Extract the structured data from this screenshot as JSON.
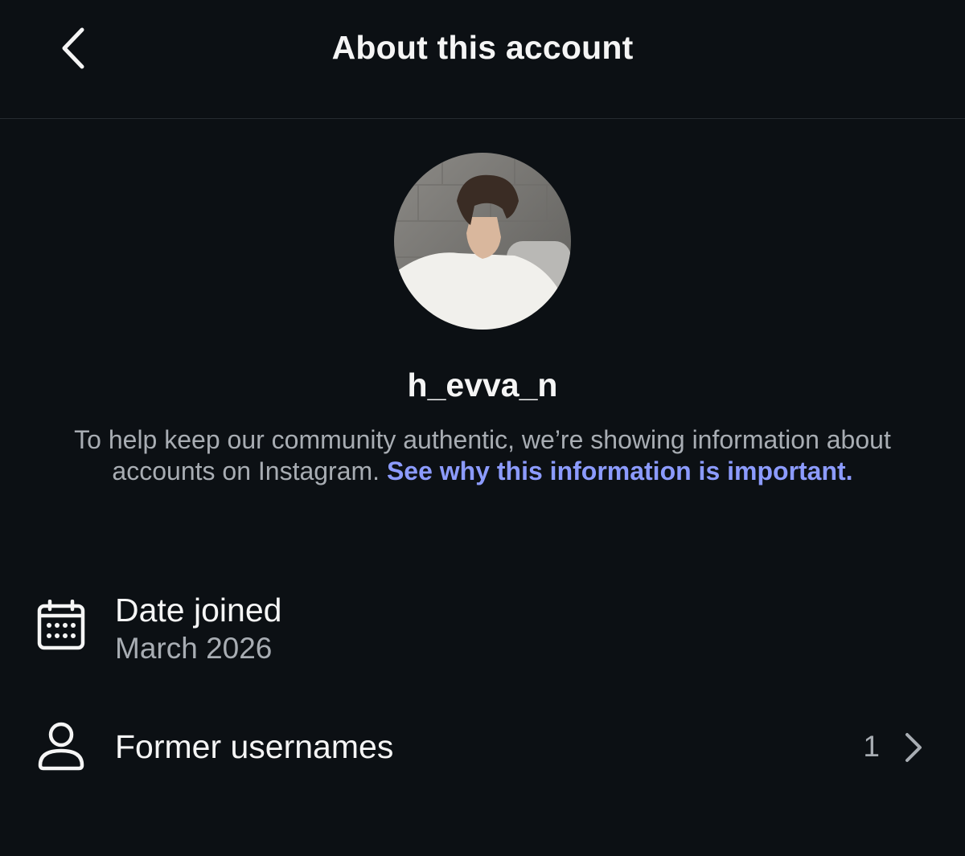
{
  "header": {
    "title": "About this account",
    "back_icon": "chevron-left-icon"
  },
  "profile": {
    "username": "h_evva_n"
  },
  "info": {
    "text": "To help keep our community authentic, we’re showing information about accounts on Instagram.",
    "link": "See why this information is important."
  },
  "details": {
    "date_joined": {
      "icon": "calendar-icon",
      "label": "Date joined",
      "value": "March 2026"
    },
    "former_usernames": {
      "icon": "person-icon",
      "label": "Former usernames",
      "count": "1"
    }
  },
  "colors": {
    "background": "#0c1014",
    "text": "#f5f5f5",
    "secondary_text": "#a8adb3",
    "link": "#8c9bff"
  }
}
